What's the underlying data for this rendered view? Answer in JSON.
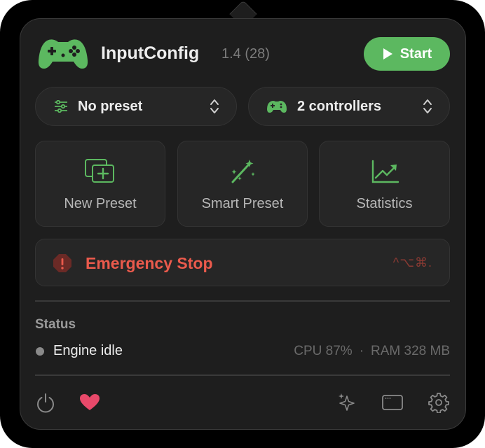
{
  "app": {
    "name": "InputConfig",
    "version": "1.4 (28)",
    "start_label": "Start",
    "brand_color": "#5cb860"
  },
  "selectors": {
    "preset": {
      "label": "No preset",
      "icon": "sliders-icon"
    },
    "controllers": {
      "label": "2 controllers",
      "icon": "gamepad-icon"
    }
  },
  "tiles": [
    {
      "label": "New Preset",
      "icon": "new-preset-icon"
    },
    {
      "label": "Smart Preset",
      "icon": "magic-wand-icon"
    },
    {
      "label": "Statistics",
      "icon": "chart-icon"
    }
  ],
  "emergency": {
    "label": "Emergency Stop",
    "shortcut": "^⌥⌘.",
    "color": "#ea5a4c"
  },
  "status": {
    "heading": "Status",
    "text": "Engine idle",
    "cpu": "CPU 87%",
    "separator": "·",
    "ram": "RAM 328 MB"
  },
  "footer": {
    "icons": [
      "power-icon",
      "heart-icon",
      "sparkles-icon",
      "window-icon",
      "gear-icon"
    ],
    "heart_color": "#e8496a"
  }
}
